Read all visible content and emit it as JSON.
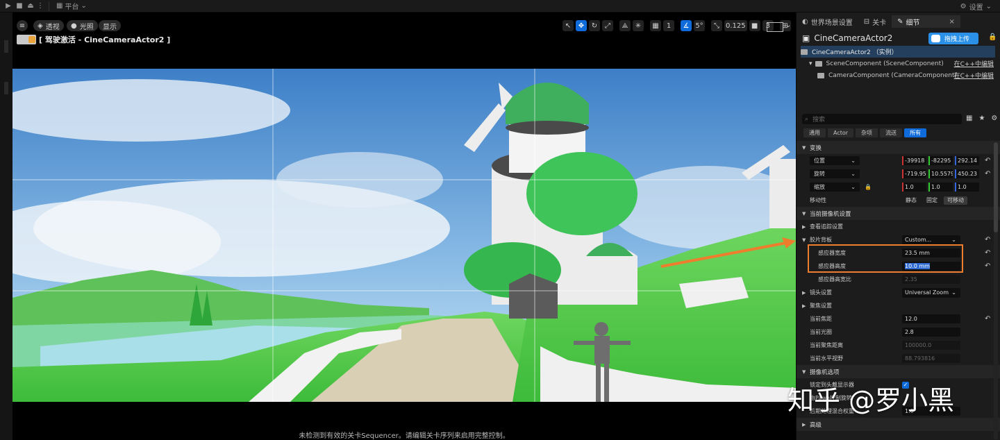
{
  "toolbar": {
    "play_icon": "play-icon",
    "stop_icon": "stop-icon",
    "eject_icon": "eject-icon",
    "platform_label": "平台",
    "settings_label": "设置"
  },
  "viewport": {
    "perspective_label": "透视",
    "lit_label": "光照",
    "show_label": "显示",
    "camera_title": "[ 驾驶激活 - CineCameraActor2 ]",
    "grid_size": "1",
    "angle_snap": "5°",
    "scale_snap": "0.125",
    "camera_speed": "3",
    "footer_message": "未检测到有效的关卡Sequencer。请编辑关卡序列来启用完整控制。"
  },
  "panel": {
    "tabs": [
      {
        "label": "世界场景设置"
      },
      {
        "label": "关卡"
      },
      {
        "label": "细节"
      }
    ],
    "actor_name": "CineCameraActor2",
    "upload_label": "拖拽上传",
    "tree": [
      {
        "label": "CineCameraActor2 （实例）",
        "edit": ""
      },
      {
        "label": "SceneComponent (SceneComponent)",
        "edit": "在C++中编辑"
      },
      {
        "label": "CameraComponent (CameraComponent)",
        "edit": "在C++中编辑"
      }
    ],
    "search_placeholder": "搜索",
    "filters": [
      "通用",
      "Actor",
      "杂项",
      "流送",
      "所有"
    ],
    "active_filter": "所有",
    "transform": {
      "section": "变换",
      "location_label": "位置",
      "location": [
        "-39918",
        "-82295",
        "292.14"
      ],
      "rotation_label": "旋转",
      "rotation": [
        "-719.95",
        "10.5579",
        "450.23"
      ],
      "scale_label": "缩放",
      "scale": [
        "1.0",
        "1.0",
        "1.0"
      ],
      "mobility_label": "移动性",
      "mobility_options": [
        "静态",
        "固定",
        "可移动"
      ],
      "mobility_selected": "可移动"
    },
    "camera": {
      "current_settings": "当前摄像机设置",
      "lookat": "查看追踪设置",
      "filmback": "胶片背板",
      "filmback_preset": "Custom...",
      "sensor_width_label": "感应器宽度",
      "sensor_width": "23.5 mm",
      "sensor_height_label": "感应器高度",
      "sensor_height": "10.0 mm",
      "aspect_label": "感应器高宽比",
      "aspect": "2.35",
      "lens_label": "镜头设置",
      "lens_preset": "Universal Zoom",
      "focus_label": "聚焦设置",
      "focal_length_label": "当前焦距",
      "focal_length": "12.0",
      "aperture_label": "当前光圈",
      "aperture": "2.8",
      "focus_distance_label": "当前聚焦距离",
      "focus_distance": "100000.0",
      "hfov_label": "当前水平视野",
      "hfov": "88.793816",
      "options_label": "摄像机选项",
      "lock_hmd_label": "锁定到头戴显示器",
      "pawn_rot_label": "由Pawn控制旋转",
      "pp_blend_label": "后期处理混合权重",
      "pp_blend": "1.0",
      "advanced_label": "高级"
    }
  },
  "watermark": "知乎 @罗小黑",
  "colors": {
    "accent": "#0e6bd9",
    "highlight": "#ee7e2d",
    "upload": "#2b90e8"
  }
}
